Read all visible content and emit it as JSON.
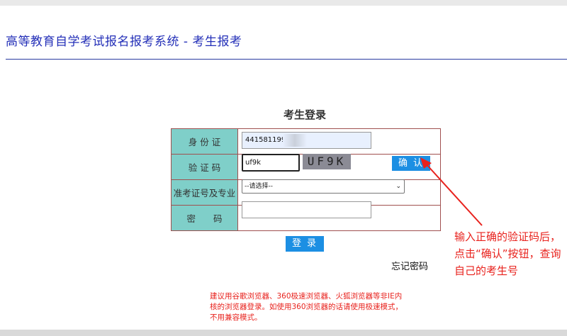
{
  "header": {
    "system_title": "高等教育自学考试报名报考系统 - 考生报考"
  },
  "login": {
    "title": "考生登录",
    "fields": {
      "id_label": "身 份 证",
      "id_value": "44158119980",
      "code_label": "验 证 码",
      "code_value": "uf9k",
      "captcha_text": "UF9K",
      "confirm_label": "确认",
      "major_label": "准考证号及专业",
      "major_selected": "--请选择--",
      "password_label": "密　　码",
      "password_value": ""
    },
    "login_button": "登录",
    "forgot_password": "忘记密码"
  },
  "browser_note": "建议用谷歌浏览器、360极速浏览器、火狐浏览器等非IE内核的浏览器登录。如使用360浏览器的话请使用极速模式，不用兼容模式。",
  "annotation": "输入正确的验证码后，点击“确认”按钮，查询自己的考生号",
  "colors": {
    "title_blue": "#2430b8",
    "label_teal": "#7fcfc9",
    "button_blue": "#1c8fe3",
    "warning_red": "#e8221d"
  }
}
